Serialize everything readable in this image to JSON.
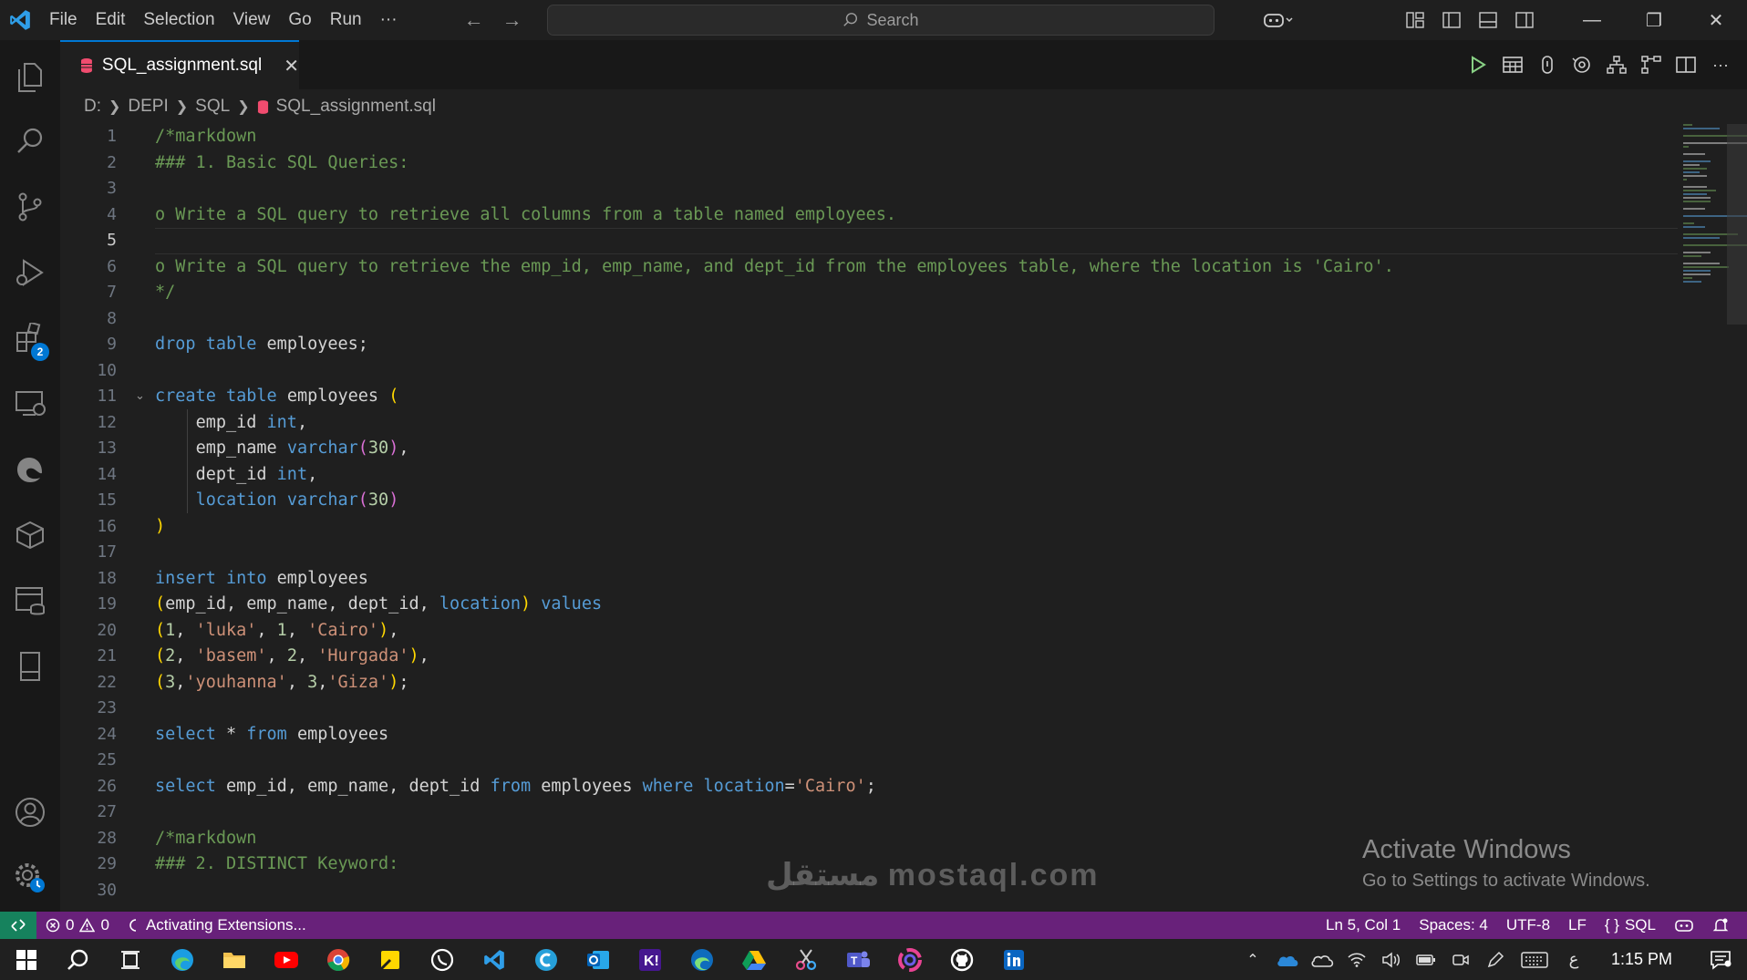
{
  "titlebar": {
    "menu": [
      "File",
      "Edit",
      "Selection",
      "View",
      "Go",
      "Run",
      "···"
    ],
    "search_placeholder": "Search"
  },
  "tab": {
    "label": "SQL_assignment.sql"
  },
  "breadcrumb": [
    "D:",
    "DEPI",
    "SQL",
    "SQL_assignment.sql"
  ],
  "activity": {
    "extensions_badge": "2"
  },
  "editor": {
    "line_numbers": [
      "1",
      "2",
      "3",
      "4",
      "5",
      "6",
      "7",
      "8",
      "9",
      "10",
      "11",
      "12",
      "13",
      "14",
      "15",
      "16",
      "17",
      "18",
      "19",
      "20",
      "21",
      "22",
      "23",
      "24",
      "25",
      "26",
      "27",
      "28",
      "29",
      "30"
    ],
    "active_line": "5"
  },
  "watermark": {
    "title": "Activate Windows",
    "subtitle": "Go to Settings to activate Windows.",
    "brand": "مستقل mostaql.com"
  },
  "statusbar": {
    "errors": "0",
    "warnings": "0",
    "activity": "Activating Extensions...",
    "position": "Ln 5, Col 1",
    "spaces": "Spaces: 4",
    "encoding": "UTF-8",
    "eol": "LF",
    "language": "SQL"
  },
  "taskbar": {
    "time": "1:15 PM",
    "lang": "ع"
  },
  "colors": {
    "accent": "#0078d4",
    "statusbar": "#68217a",
    "remote": "#16825d",
    "comment": "#6a9955",
    "keyword": "#569cd6",
    "string": "#ce9178"
  }
}
